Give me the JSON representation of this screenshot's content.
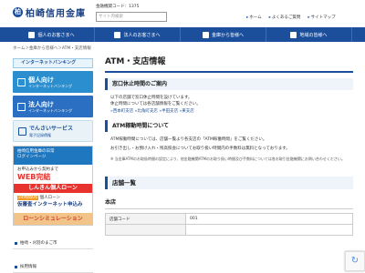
{
  "header": {
    "logo_mark": "柏",
    "logo_text": "柏崎信用金庫",
    "bank_code": "金融機関コード：1375",
    "search_placeholder": "サイト内検索",
    "links": [
      "ホーム",
      "よくあるご質問",
      "サイトマップ"
    ]
  },
  "nav": {
    "items": [
      "個人のお客さまへ",
      "法人のお客さまへ",
      "金庫から皆様へ",
      "地域の皆様へ"
    ]
  },
  "breadcrumb": "ホーム＞金庫から皆様へ＞ATM・支店情報",
  "sidebar": {
    "heading": "インターネットバンキング",
    "personal": {
      "main": "個人向け",
      "sub": "インターネットバンキング"
    },
    "corporate": {
      "main": "法人向け",
      "sub": "インターネットバンキング"
    },
    "denshi": {
      "main": "でんさいサービス",
      "sub": "電子記録債権"
    },
    "banner_login": [
      "柏崎信用金庫の日常",
      "ログインページ"
    ],
    "banner_web": {
      "line1": "お申込みから契約まで",
      "line2": "WEB完結"
    },
    "banner_shinkin": "しんきん個人ローン",
    "banner_loan": {
      "badge": "24時間OK",
      "line1": "個人ローン",
      "line2": "仮審査インターネット申込み"
    },
    "banner_sim": "ローンシミュレーション",
    "links": [
      "柏崎・刈羽のまご市",
      "採用情報"
    ]
  },
  "main": {
    "title": "ATM・支店情報",
    "section1": {
      "heading": "窓口休止時間のご案内",
      "lines": [
        "以下の店舗で窓口休止時間を設けています。",
        "休止時間については各店舗情報をご覧ください。"
      ],
      "links": "»西本町支店 »比角町支店 »半田支店 »東支店"
    },
    "section2": {
      "heading": "ATM稼動時間について",
      "lines": [
        "ATM稼動時間については、店舗一覧より各支店の「ATM稼働時間」をご覧ください。",
        "お引き出し・お預け入れ・残高照会についてお取り扱い時間内の手数料は無料となっております。"
      ],
      "note": "※ 当金庫ATMのお取扱時間の設定により、他金融機関ATMのお取り扱い時間及び手数料については各お取引金融機関にお問い合わせください。"
    },
    "store_list": "店舗一覧",
    "branch": {
      "name": "本店",
      "rows": [
        {
          "label": "店舗コード",
          "value": "001"
        },
        {
          "label": "",
          "value": ""
        }
      ]
    }
  }
}
